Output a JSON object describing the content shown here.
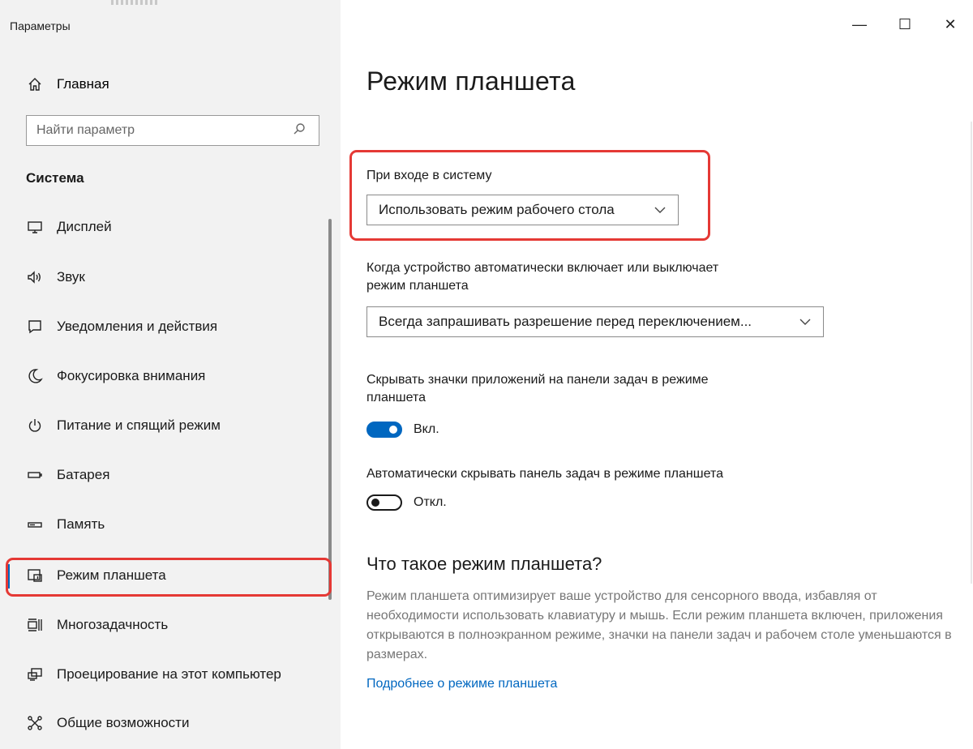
{
  "app": {
    "title": "Параметры"
  },
  "window_controls": {
    "minimize": "—",
    "maximize": "☐",
    "close": "✕"
  },
  "sidebar": {
    "home_label": "Главная",
    "search": {
      "placeholder": "Найти параметр",
      "value": ""
    },
    "section_title": "Система",
    "items": [
      {
        "label": "Дисплей",
        "icon": "display-icon"
      },
      {
        "label": "Звук",
        "icon": "sound-icon"
      },
      {
        "label": "Уведомления и действия",
        "icon": "notifications-icon"
      },
      {
        "label": "Фокусировка внимания",
        "icon": "moon-icon"
      },
      {
        "label": "Питание и спящий режим",
        "icon": "power-icon"
      },
      {
        "label": "Батарея",
        "icon": "battery-icon"
      },
      {
        "label": "Память",
        "icon": "storage-icon"
      },
      {
        "label": "Режим планшета",
        "icon": "tablet-mode-icon",
        "selected": true
      },
      {
        "label": "Многозадачность",
        "icon": "multitasking-icon"
      },
      {
        "label": "Проецирование на этот компьютер",
        "icon": "projecting-icon"
      },
      {
        "label": "Общие возможности",
        "icon": "shared-experiences-icon"
      }
    ]
  },
  "main": {
    "page_title": "Режим планшета",
    "login_label": "При входе в систему",
    "login_dropdown_value": "Использовать режим рабочего стола",
    "auto_switch_label_line1": "Когда устройство автоматически включает или выключает",
    "auto_switch_label_line2": "режим планшета",
    "auto_switch_dropdown_value": "Всегда запрашивать разрешение перед переключением...",
    "hide_icons_label_line1": "Скрывать значки приложений на панели задач в режиме",
    "hide_icons_label_line2": "планшета",
    "hide_icons_toggle": {
      "state": "on",
      "label": "Вкл."
    },
    "autohide_label": "Автоматически скрывать панель задач в режиме планшета",
    "autohide_toggle": {
      "state": "off",
      "label": "Откл."
    },
    "what_is_heading": "Что такое режим планшета?",
    "description": "Режим планшета оптимизирует ваше устройство для сенсорного ввода, избавляя от необходимости использовать клавиатуру и мышь. Если режим планшета включен, приложения открываются в полноэкранном режиме, значки на панели задач и рабочем столе уменьшаются в размерах.",
    "learn_more_link": "Подробнее о режиме планшета"
  },
  "colors": {
    "accent": "#0067c0",
    "highlight": "#e53935",
    "sidebar_bg": "#f2f2f2"
  }
}
